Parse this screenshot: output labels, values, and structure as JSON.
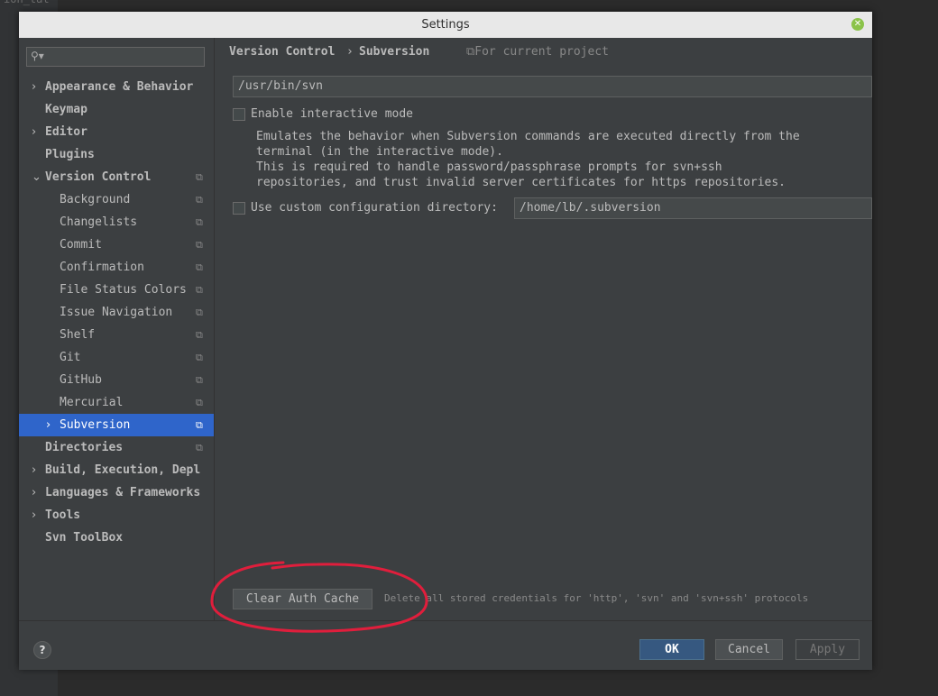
{
  "background_text": "ion_tat",
  "dialog": {
    "title": "Settings"
  },
  "search": {
    "icon": "search-icon",
    "value": ""
  },
  "sidebar": {
    "items": [
      {
        "label": "Appearance & Behavior",
        "arrow": "›",
        "bold": true
      },
      {
        "label": "Keymap",
        "arrow": "",
        "bold": true
      },
      {
        "label": "Editor",
        "arrow": "›",
        "bold": true
      },
      {
        "label": "Plugins",
        "arrow": "",
        "bold": true
      },
      {
        "label": "Version Control",
        "arrow": "⌄",
        "bold": true,
        "copy": true
      },
      {
        "label": "Background",
        "child": true,
        "copy": true
      },
      {
        "label": "Changelists",
        "child": true,
        "copy": true
      },
      {
        "label": "Commit",
        "child": true,
        "copy": true
      },
      {
        "label": "Confirmation",
        "child": true,
        "copy": true
      },
      {
        "label": "File Status Colors",
        "child": true,
        "copy": true
      },
      {
        "label": "Issue Navigation",
        "child": true,
        "copy": true
      },
      {
        "label": "Shelf",
        "child": true,
        "copy": true
      },
      {
        "label": "Git",
        "child": true,
        "copy": true
      },
      {
        "label": "GitHub",
        "child": true,
        "copy": true
      },
      {
        "label": "Mercurial",
        "child": true,
        "copy": true
      },
      {
        "label": "Subversion",
        "arrow": "›",
        "child": true,
        "copy": true,
        "selected": true
      },
      {
        "label": "Directories",
        "arrow": "",
        "bold": true,
        "copy": true
      },
      {
        "label": "Build, Execution, Depl",
        "arrow": "›",
        "bold": true
      },
      {
        "label": "Languages & Frameworks",
        "arrow": "›",
        "bold": true
      },
      {
        "label": "Tools",
        "arrow": "›",
        "bold": true
      },
      {
        "label": "Svn ToolBox",
        "arrow": "",
        "bold": true
      }
    ]
  },
  "breadcrumb": {
    "part1": "Version Control",
    "separator": "›",
    "part2": "Subversion",
    "scope": "⧉For current project"
  },
  "content": {
    "svn_path": "/usr/bin/svn",
    "interactive_label": "Enable interactive mode",
    "interactive_checked": false,
    "desc_line1": "Emulates the behavior when Subversion commands are executed directly from the",
    "desc_line2": "terminal (in the interactive mode).",
    "desc_line3": "This is required to handle password/passphrase prompts for svn+ssh",
    "desc_line4": "repositories, and trust invalid server certificates for https repositories.",
    "custom_dir_label": "Use custom configuration directory:",
    "custom_dir_checked": false,
    "custom_dir_value": "/home/lb/.subversion",
    "clear_button": "Clear Auth Cache",
    "clear_desc": "Delete all stored credentials for 'http', 'svn' and 'svn+ssh' protocols"
  },
  "footer": {
    "help": "?",
    "ok": "OK",
    "cancel": "Cancel",
    "apply": "Apply"
  },
  "colors": {
    "selection": "#2f65ca",
    "annotation": "#e01e3c",
    "ok_button": "#365880"
  }
}
